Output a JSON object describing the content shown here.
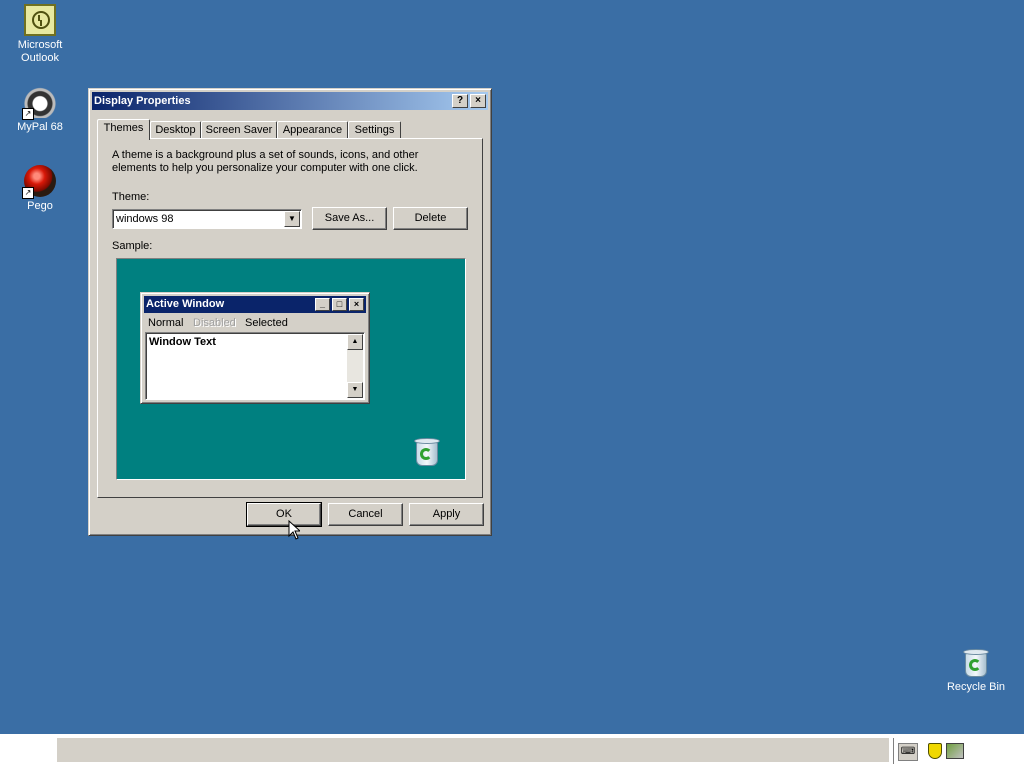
{
  "desktop": {
    "icons": [
      {
        "label": "Microsoft Outlook",
        "icon": "outlook-icon"
      },
      {
        "label": "MyPal 68",
        "icon": "mypal-icon"
      },
      {
        "label": "Pego",
        "icon": "pego-icon"
      },
      {
        "label": "Recycle Bin",
        "icon": "recycle-bin-icon"
      }
    ],
    "background_color": "#3a6ea5"
  },
  "dialog": {
    "title": "Display Properties",
    "help_btn": "?",
    "close_btn": "×",
    "tabs": [
      {
        "label": "Themes",
        "active": true
      },
      {
        "label": "Desktop"
      },
      {
        "label": "Screen Saver"
      },
      {
        "label": "Appearance"
      },
      {
        "label": "Settings"
      }
    ],
    "description": "A theme is a background plus a set of sounds, icons, and other elements to help you personalize your computer with one click.",
    "theme_label": "Theme:",
    "theme_value": "windows 98",
    "save_as": "Save As...",
    "delete": "Delete",
    "sample_label": "Sample:",
    "sample": {
      "window_title": "Active Window",
      "menu": {
        "normal": "Normal",
        "disabled": "Disabled",
        "selected": "Selected"
      },
      "window_text": "Window Text",
      "background_color": "#008080"
    },
    "ok": "OK",
    "cancel": "Cancel",
    "apply": "Apply"
  },
  "colors": {
    "title_active": "#0a246a",
    "title_gradient_end": "#a6caf0",
    "face": "#d4d0c8"
  }
}
